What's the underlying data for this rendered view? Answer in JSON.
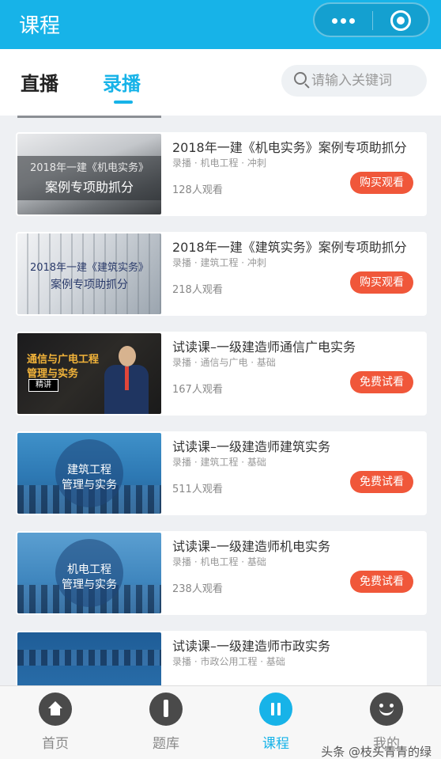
{
  "header": {
    "title": "课程"
  },
  "tabs": [
    {
      "label": "直播",
      "active": false
    },
    {
      "label": "录播",
      "active": true
    }
  ],
  "search": {
    "placeholder": "请输入关键词"
  },
  "courses": [
    {
      "title": "2018年一建《机电实务》案例专项助抓分",
      "tags": "录播 · 机电工程 · 冲刺",
      "views": "128人观看",
      "button": "购买观看",
      "thumb_lines": [
        "2018年一建《机电实务》",
        "案例专项助抓分"
      ]
    },
    {
      "title": "2018年一建《建筑实务》案例专项助抓分",
      "tags": "录播 · 建筑工程 · 冲刺",
      "views": "218人观看",
      "button": "购买观看",
      "thumb_lines": [
        "2018年一建《建筑实务》",
        "案例专项助抓分"
      ]
    },
    {
      "title": "试读课–一级建造师通信广电实务",
      "tags": "录播 · 通信与广电 · 基础",
      "views": "167人观看",
      "button": "免费试看",
      "thumb_lines": [
        "通信与广电工程",
        "管理与实务"
      ],
      "thumb_badge": "精讲"
    },
    {
      "title": "试读课–一级建造师建筑实务",
      "tags": "录播 · 建筑工程 · 基础",
      "views": "511人观看",
      "button": "免费试看",
      "thumb_lines": [
        "建筑工程",
        "管理与实务"
      ]
    },
    {
      "title": "试读课–一级建造师机电实务",
      "tags": "录播 · 机电工程 · 基础",
      "views": "238人观看",
      "button": "免费试看",
      "thumb_lines": [
        "机电工程",
        "管理与实务"
      ]
    },
    {
      "title": "试读课–一级建造师市政实务",
      "tags": "录播 · 市政公用工程 · 基础",
      "views": "",
      "button": ""
    }
  ],
  "bottom_nav": [
    {
      "label": "首页",
      "icon": "home-icon",
      "active": false
    },
    {
      "label": "题库",
      "icon": "pencil-icon",
      "active": false
    },
    {
      "label": "课程",
      "icon": "pause-icon",
      "active": true
    },
    {
      "label": "我的",
      "icon": "smile-icon",
      "active": false
    }
  ],
  "watermark": "头条 @枝头青青的绿",
  "colors": {
    "primary": "#17b3e8",
    "button": "#f0573a"
  }
}
